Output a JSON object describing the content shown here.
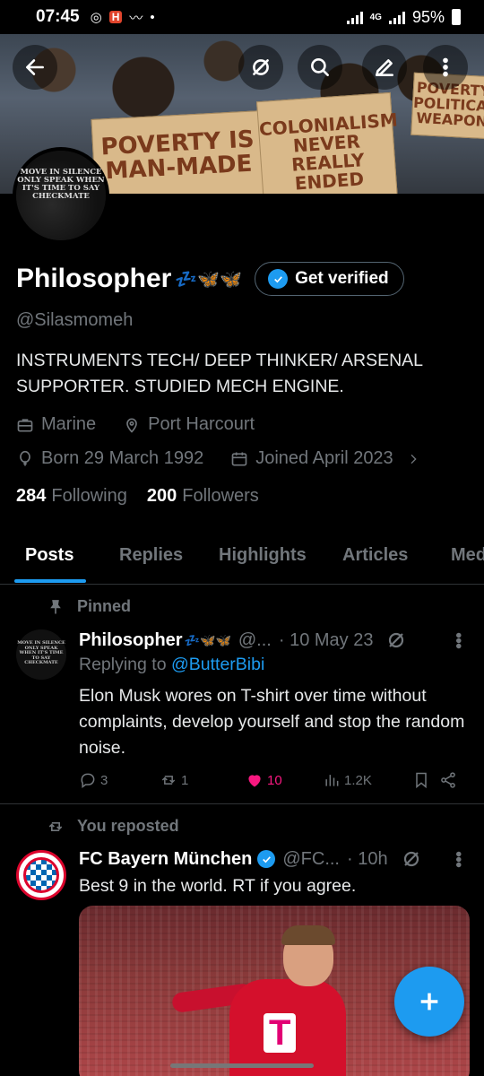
{
  "status_bar": {
    "time": "07:45",
    "battery": "95%",
    "network": "4G"
  },
  "banner": {
    "placard1": "POVERTY IS MAN-MADE",
    "placard2": "COLONIALISM NEVER REALLY ENDED",
    "placard3": "POVERTY POLITICAL WEAPON"
  },
  "header": {
    "back_icon": "arrow-left-icon",
    "grok_icon": "grok-icon",
    "search_icon": "search-icon",
    "edit_icon": "pencil-icon",
    "more_icon": "more-vertical-icon"
  },
  "avatar": {
    "text": "MOVE IN SILENCE ONLY SPEAK WHEN IT'S TIME TO SAY CHECKMATE"
  },
  "profile": {
    "name": "Philosopher",
    "name_emoji": "💤🦋🦋",
    "verify_label": "Get verified",
    "handle": "@Silasmomeh",
    "bio": "INSTRUMENTS  TECH/ DEEP THINKER/ ARSENAL SUPPORTER.  STUDIED MECH ENGINE.",
    "work": "Marine",
    "location": "Port Harcourt",
    "born": "Born 29 March 1992",
    "joined": "Joined April 2023",
    "following_count": "284",
    "following_label": "Following",
    "followers_count": "200",
    "followers_label": "Followers"
  },
  "tabs": [
    "Posts",
    "Replies",
    "Highlights",
    "Articles",
    "Media"
  ],
  "active_tab": "Posts",
  "posts": [
    {
      "context": "Pinned",
      "name": "Philosopher",
      "name_emoji": "💤🦋🦋",
      "handle": "@...",
      "time": "· 10 May 23",
      "reply_prefix": "Replying to",
      "reply_to": "@ButterBibi",
      "text": "Elon Musk wores on T-shirt over time without complaints, develop yourself and stop the random noise.",
      "replies": "3",
      "reposts": "1",
      "likes": "10",
      "views": "1.2K"
    },
    {
      "context": "You reposted",
      "name": "FC Bayern München",
      "handle": "@FC...",
      "time": "· 10h",
      "text": "Best 9 in the world. RT if you agree.",
      "media_text": "T"
    }
  ],
  "colors": {
    "accent": "#1d9bf0",
    "like": "#f91880",
    "muted": "#71767b",
    "background": "#000000"
  }
}
